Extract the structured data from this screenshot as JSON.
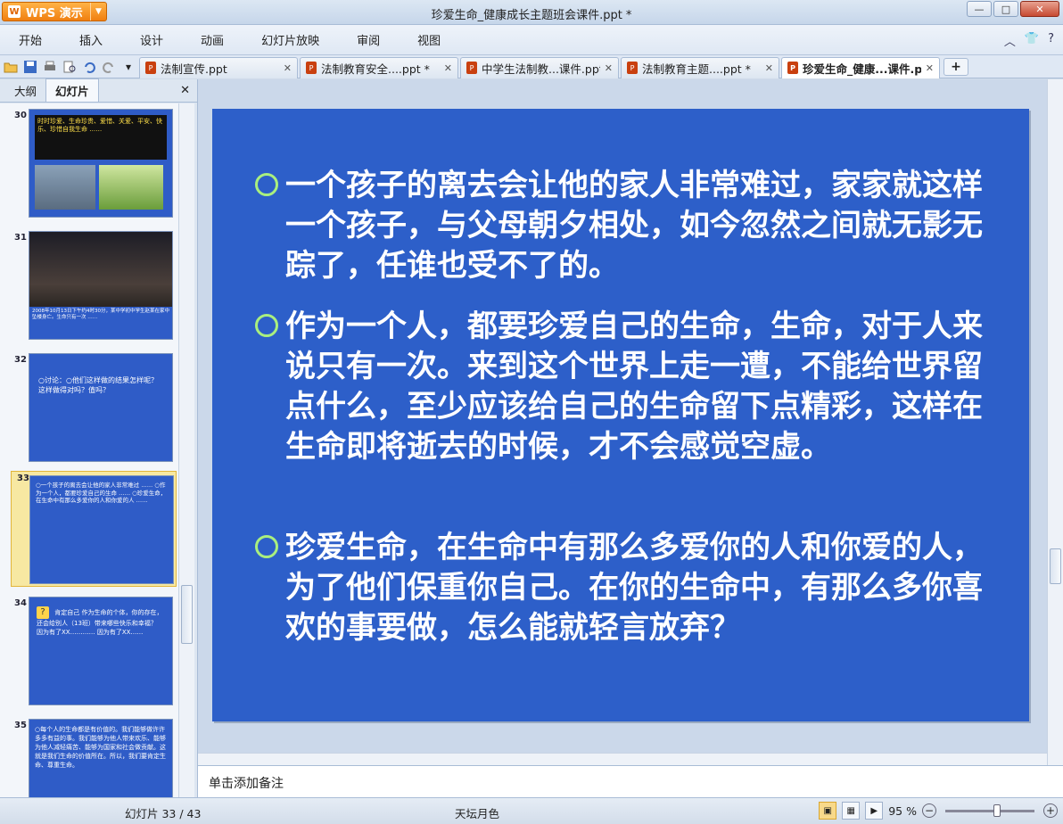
{
  "app": {
    "brand": "WPS 演示",
    "title": "珍爱生命_健康成长主题班会课件.ppt *"
  },
  "menu": [
    "开始",
    "插入",
    "设计",
    "动画",
    "幻灯片放映",
    "审阅",
    "视图"
  ],
  "tabs": [
    {
      "label": "法制宣传.ppt",
      "active": false
    },
    {
      "label": "法制教育安全....ppt *",
      "active": false
    },
    {
      "label": "中学生法制教...课件.ppt",
      "active": false
    },
    {
      "label": "法制教育主题....ppt *",
      "active": false
    },
    {
      "label": "珍爱生命_健康...课件.ppt *",
      "active": true
    }
  ],
  "panel": {
    "tab_outline": "大纲",
    "tab_slides": "幻灯片"
  },
  "thumbnails": [
    {
      "num": "30",
      "text": "时时珍爱、生命珍贵、爱惜、关爱、平安、快乐、珍惜自我生命 ……"
    },
    {
      "num": "31",
      "text": "2008年10月13日下午约4时30分，某中学初中学生赵某在家中坠楼身亡。生命只有一次 ……"
    },
    {
      "num": "32",
      "text": "○讨论：○他们这样做的结果怎样呢？这样做得对吗？值吗？"
    },
    {
      "num": "33",
      "text": "○一个孩子的离去会让他的家人非常难过 …… ○作为一个人，都要珍爱自己的生命 …… ○珍爱生命，在生命中有那么多爱你的人和你爱的人 ……"
    },
    {
      "num": "34",
      "text": "肯定自己 作为生命的个体，你的存在，还会给别人（13班）带来哪些快乐和幸福？ 因为有了XX………… 因为有了XX……"
    },
    {
      "num": "35",
      "text": "○每个人的生命都是有价值的。我们能够做许许多多有益的事。我们能够为他人带来欢乐、能够为他人减轻痛苦、能够为国家和社会做贡献。这就是我们生命的价值所在。所以，我们要肯定生命、尊重生命。"
    }
  ],
  "slide": {
    "bullets": [
      "一个孩子的离去会让他的家人非常难过，家家就这样一个孩子，与父母朝夕相处，如今忽然之间就无影无踪了，任谁也受不了的。",
      "作为一个人，都要珍爱自己的生命，生命，对于人来说只有一次。来到这个世界上走一遭，不能给世界留点什么，至少应该给自己的生命留下点精彩，这样在生命即将逝去的时候，才不会感觉空虚。",
      "珍爱生命，在生命中有那么多爱你的人和你爱的人，为了他们保重你自己。在你的生命中，有那么多你喜欢的事要做，怎么能就轻言放弃？"
    ]
  },
  "notes": {
    "placeholder": "单击添加备注"
  },
  "status": {
    "slide_counter": "幻灯片 33 / 43",
    "theme": "天坛月色",
    "zoom": "95 %"
  },
  "colors": {
    "slide_bg": "#2d5fc9",
    "bullet_marker": "#a9ef7f",
    "accent": "#f07f10"
  }
}
